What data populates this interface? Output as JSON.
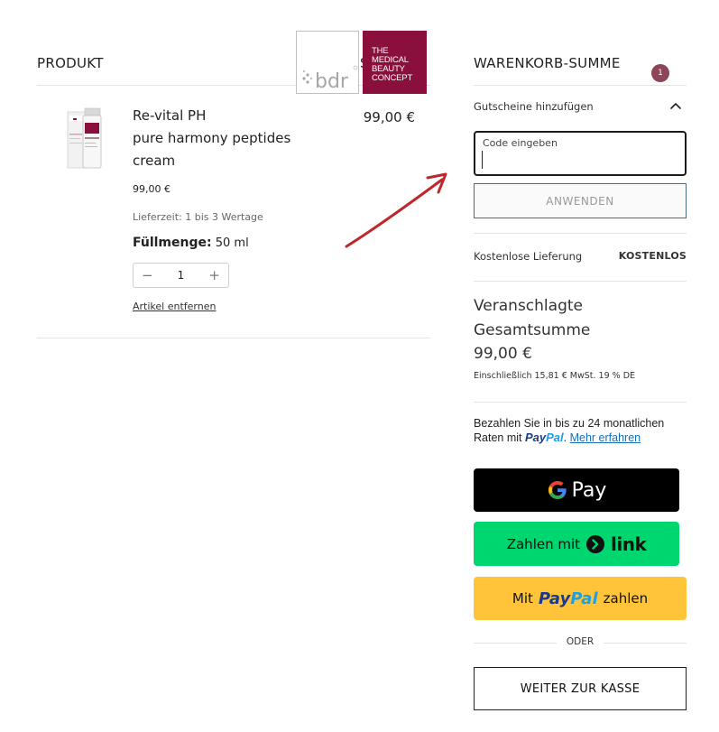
{
  "cart": {
    "col_product": "PRODUKT",
    "col_sum_partial": "S",
    "item": {
      "name_line1": "Re-vital PH",
      "name_line2": "pure harmony peptides",
      "name_line3": "cream",
      "price": "99,00 €",
      "line_total": "99,00 €",
      "delivery": "Lieferzeit: 1 bis 3 Wertage",
      "fill_label": "Füllmenge:",
      "fill_value": " 50 ml",
      "quantity": "1",
      "minus": "−",
      "plus": "+",
      "remove": "Artikel entfernen"
    }
  },
  "logo": {
    "left_text": "bdr",
    "right_line1": "THE",
    "right_line2": "MEDICAL",
    "right_line3": "BEAUTY",
    "right_line4": "CONCEPT",
    "brand_color": "#8b0f3c"
  },
  "summary": {
    "title": "WARENKORB-SUMME",
    "badge_count": "1",
    "voucher_toggle": "Gutscheine hinzufügen",
    "code_label": "Code eingeben",
    "code_value": "",
    "apply_button": "ANWENDEN",
    "shipping_label": "Kostenlose Lieferung",
    "shipping_value": "KOSTENLOS",
    "total_label_line1": "Veranschlagte",
    "total_label_line2": "Gesamtsumme",
    "total_value": "99,00 €",
    "tax_note": "Einschließlich 15,81 € MwSt. 19 % DE"
  },
  "payment": {
    "paypal_msg_1": "Bezahlen Sie in bis zu 24 monatlichen",
    "paypal_msg_2": "Raten mit",
    "paypal_word_pay": "Pay",
    "paypal_word_pal": "Pal",
    "paypal_learn_more": "Mehr erfahren",
    "gpay_label": "Pay",
    "link_prefix": "Zahlen mit",
    "link_brand": "link",
    "paypal_btn_prefix": "Mit",
    "paypal_btn_suffix": "zahlen",
    "or_label": "ODER",
    "checkout_button": "WEITER ZUR KASSE"
  },
  "colors": {
    "accent": "#8b0f3c",
    "badge": "#8c4658",
    "gpay_bg": "#000000",
    "link_bg": "#00d66f",
    "paypal_bg": "#ffc439",
    "annotation_arrow": "#c0272d"
  },
  "icons": {
    "chevron": "chevron-up-icon",
    "annotation": "red-arrow-annotation"
  }
}
